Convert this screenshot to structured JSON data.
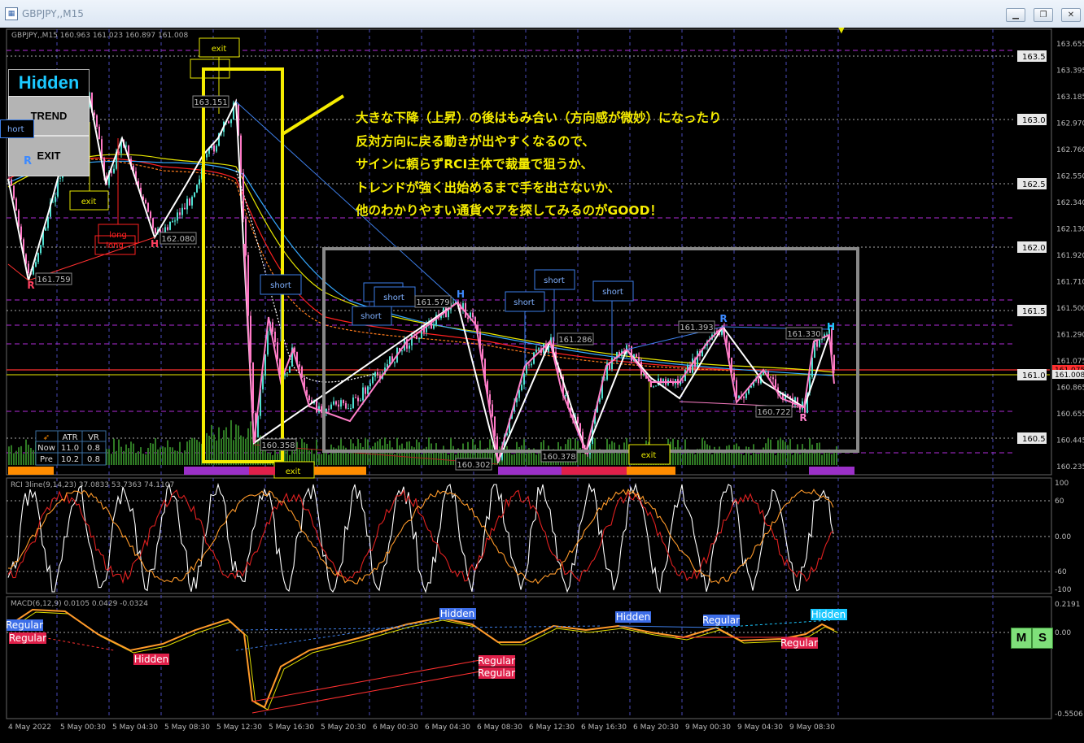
{
  "window": {
    "title": "GBPJPY,,M15",
    "minimize": "▁",
    "restore": "❐",
    "close": "✕"
  },
  "chart_header": "GBPJPY,,M15  160.963 161.023 160.897 161.008",
  "price_axis": {
    "labels": [
      "163.655",
      "163.395",
      "163.185",
      "162.970",
      "162.760",
      "162.550",
      "162.340",
      "162.130",
      "161.920",
      "161.710",
      "161.500",
      "161.290",
      "161.075",
      "160.865",
      "160.655",
      "160.445",
      "160.235"
    ],
    "round_levels": [
      "163.5",
      "163.0",
      "162.5",
      "162.0",
      "161.5",
      "161.0",
      "160.5"
    ],
    "current_price": "161.008",
    "highlight_label": "161.075"
  },
  "time_axis": [
    "4 May 2022",
    "5 May 00:30",
    "5 May 04:30",
    "5 May 08:30",
    "5 May 12:30",
    "5 May 16:30",
    "5 May 20:30",
    "6 May 00:30",
    "6 May 04:30",
    "6 May 08:30",
    "6 May 12:30",
    "6 May 16:30",
    "6 May 20:30",
    "9 May 00:30",
    "9 May 04:30",
    "9 May 08:30"
  ],
  "panel_buttons": {
    "mode": "Hidden",
    "trend": "TREND",
    "exit": "EXIT",
    "short_tab": "hort",
    "r_mark": "R"
  },
  "annotation_lines": [
    "大きな下降（上昇）の後はもみ合い（方向感が微妙）になったり",
    "反対方向に戻る動きが出やすくなるので、",
    "サインに頼らずRCI主体で裁量で狙うか、",
    "トレンドが強く出始めるまで手を出さないか、",
    "他のわかりやすい通貨ペアを探してみるのがGOOD！"
  ],
  "signals": {
    "exit": "exit",
    "long": "long",
    "short": "short"
  },
  "price_tags": {
    "t1": "161.759",
    "t2": "162.080",
    "t3": "163.151",
    "t4": "161.579",
    "t5": "161.286",
    "t6": "161.393",
    "t7": "161.330",
    "t8": "160.722",
    "t9": "160.358",
    "t10": "160.378",
    "t11": "160.302"
  },
  "zigzag_marks": {
    "h": "H",
    "r": "R"
  },
  "atr_table": {
    "headers": [
      "ATR",
      "VR"
    ],
    "rows": [
      {
        "label": "Now",
        "atr": "11.0",
        "vr": "0.8"
      },
      {
        "label": "Pre",
        "atr": "10.2",
        "vr": "0.8"
      }
    ]
  },
  "rci": {
    "header": "RCI 3line(9,14,23) 37.0833 53.7363 74.1107",
    "levels": [
      "100",
      "60",
      "0.00",
      "-60",
      "-100"
    ]
  },
  "macd": {
    "header": "MACD(6,12,9) 0.0105 0.0429 -0.0324",
    "levels": [
      "0.2191",
      "0.00",
      "-0.5506"
    ],
    "hidden": "Hidden",
    "regular": "Regular",
    "m": "M",
    "s": "S"
  },
  "colors": {
    "yellow": "#f5ec00",
    "pink": "#ff79c6",
    "white": "#ffffff",
    "grid": "#5b5bd6",
    "up_candle": "#4fe0d0",
    "volume": "#2f7a24",
    "gray_box": "#888888"
  }
}
